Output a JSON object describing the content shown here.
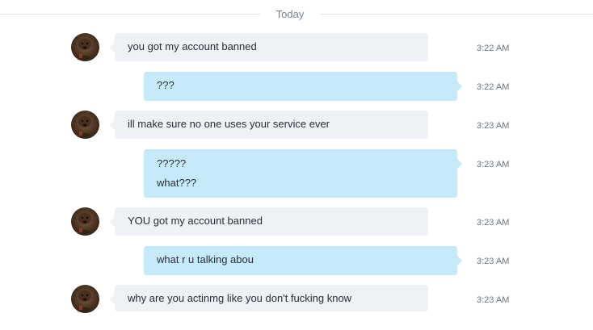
{
  "date_divider": "Today",
  "messages": [
    {
      "direction": "in",
      "lines": [
        "you got my account banned"
      ],
      "time": "3:22 AM"
    },
    {
      "direction": "out",
      "lines": [
        "???"
      ],
      "time": "3:22 AM"
    },
    {
      "direction": "in",
      "lines": [
        "ill make sure no one uses your service ever"
      ],
      "time": "3:23 AM"
    },
    {
      "direction": "out",
      "lines": [
        "?????",
        "what???"
      ],
      "time": "3:23 AM"
    },
    {
      "direction": "in",
      "lines": [
        "YOU got my account banned"
      ],
      "time": "3:23 AM"
    },
    {
      "direction": "out",
      "lines": [
        "what r u talking abou"
      ],
      "time": "3:23 AM"
    },
    {
      "direction": "in",
      "lines": [
        "why are you actinmg like you don't fucking know"
      ],
      "time": "3:23 AM"
    }
  ],
  "colors": {
    "incoming_bubble": "#eef1f5",
    "outgoing_bubble": "#c7eafb",
    "timestamp": "#6b7480"
  }
}
